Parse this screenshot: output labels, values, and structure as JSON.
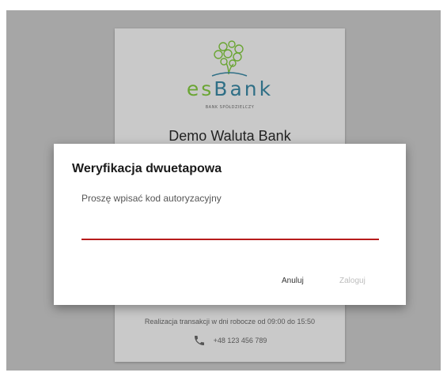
{
  "login_card": {
    "logo_word_prefix": "es",
    "logo_word_suffix": "Bank",
    "logo_subtitle": "BANK SPÓŁDZIELCZY",
    "bank_name": "Demo Waluta Bank",
    "hours_text": "Realizacja transakcji w dni robocze od 09:00 do 15:50",
    "phone": "+48 123 456 789"
  },
  "dialog": {
    "title": "Weryfikacja dwuetapowa",
    "prompt": "Proszę wpisać kod autoryzacyjny",
    "code_value": "",
    "cancel_label": "Anuluj",
    "login_label": "Zaloguj"
  },
  "colors": {
    "backdrop": "#a6a6a6",
    "card": "#c9c9c9",
    "input_underline": "#b71c1c",
    "logo_green": "#6aa533",
    "logo_blue": "#2f6f86",
    "disabled_text": "#bdbdbd"
  },
  "icons": {
    "logo": "tree-logo-icon",
    "phone": "phone-icon"
  }
}
